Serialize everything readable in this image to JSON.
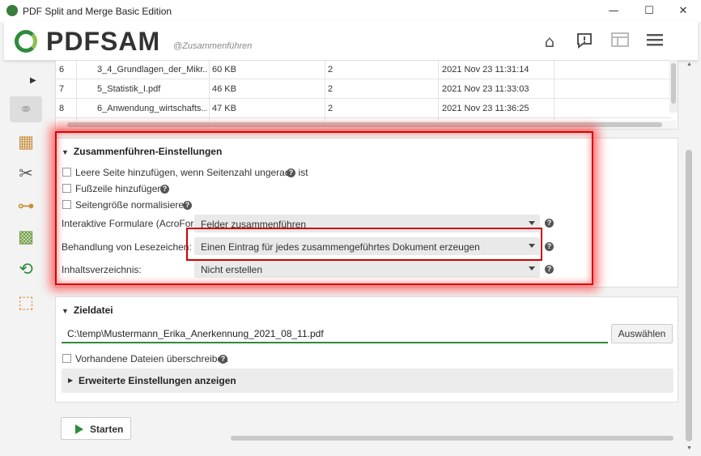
{
  "window": {
    "title": "PDF Split and Merge Basic Edition",
    "minimize": "—",
    "maximize": "☐",
    "close": "✕"
  },
  "header": {
    "brand": "PDFSAM",
    "module": "@Zusammenführen",
    "icons": [
      "home-icon",
      "feedback-icon",
      "dashboard-icon",
      "menu-icon"
    ]
  },
  "sidebar": {
    "items": [
      {
        "name": "merge-icon",
        "active": true
      },
      {
        "name": "split-icon"
      },
      {
        "name": "scissors-icon"
      },
      {
        "name": "split-by-bookmarks-icon"
      },
      {
        "name": "alternate-mix-icon"
      },
      {
        "name": "rotate-icon"
      },
      {
        "name": "extract-icon"
      }
    ]
  },
  "file_table": {
    "rows": [
      {
        "index": "6",
        "name": "3_4_Grundlagen_der_Mikr...",
        "size": "60 KB",
        "pages": "2",
        "modified": "2021 Nov 23 11:31:14"
      },
      {
        "index": "7",
        "name": "5_Statistik_I.pdf",
        "size": "46 KB",
        "pages": "2",
        "modified": "2021 Nov 23 11:33:03"
      },
      {
        "index": "8",
        "name": "6_Anwendung_wirtschafts...",
        "size": "47 KB",
        "pages": "2",
        "modified": "2021 Nov 23 11:36:25"
      }
    ]
  },
  "merge_settings": {
    "title": "Zusammenführen-Einstellungen",
    "blank_page": "Leere Seite hinzufügen, wenn Seitenzahl ungerade ist",
    "footer": "Fußzeile hinzufügen",
    "normalize": "Seitengröße normalisieren",
    "forms_label": "Interaktive Formulare (AcroForms):",
    "forms_value": "Felder zusammenführen",
    "bookmarks_label": "Behandlung von Lesezeichen:",
    "bookmarks_value": "Einen Eintrag für jedes zusammengeführtes Dokument erzeugen",
    "toc_label": "Inhaltsverzeichnis:",
    "toc_value": "Nicht erstellen",
    "help": "?"
  },
  "destination": {
    "title": "Zieldatei",
    "path": "C:\\temp\\Mustermann_Erika_Anerkennung_2021_08_11.pdf",
    "browse": "Auswählen",
    "overwrite": "Vorhandene Dateien überschreiben",
    "advanced": "Erweiterte Einstellungen anzeigen"
  },
  "run": {
    "start": "Starten"
  },
  "colors": {
    "accent": "#2e8b3a",
    "highlight": "#dd0000"
  }
}
